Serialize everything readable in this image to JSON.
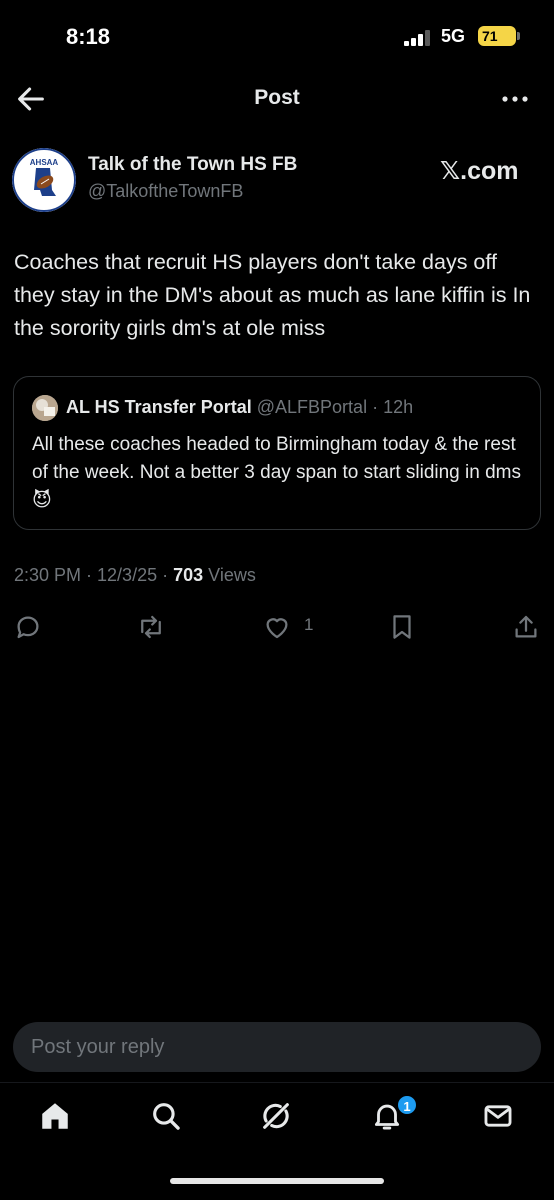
{
  "status_bar": {
    "time": "8:18",
    "network": "5G",
    "battery": "71"
  },
  "header": {
    "title": "Post"
  },
  "post": {
    "author_name": "Talk of the Town HS FB",
    "author_handle": "@TalkoftheTownFB",
    "avatar_text": "AHSAA",
    "source_label": "𝕏.com",
    "body": "Coaches that recruit HS players don't take days off they stay in the DM's about as much as lane kiffin is In the sorority girls dm's at ole miss",
    "quote": {
      "author_name": "AL HS Transfer Portal",
      "author_handle": "@ALFBPortal",
      "time": "· 12h",
      "text": "All these coaches headed to Birmingham today & the rest of the week. Not a better 3 day span to start sliding in dms 😈"
    },
    "timestamp": "2:30 PM · 12/3/25 · ",
    "views_count": "703",
    "views_label": " Views",
    "likes_count": "1"
  },
  "reply": {
    "placeholder": "Post your reply"
  },
  "nav": {
    "notifications_badge": "1"
  },
  "colors": {
    "background": "#000000",
    "text": "#e7e9ea",
    "muted": "#71767b",
    "accent": "#1d9bf0",
    "battery": "#f5d547"
  },
  "icons": [
    "back-arrow-icon",
    "more-icon",
    "reply-icon",
    "repost-icon",
    "like-icon",
    "bookmark-icon",
    "share-icon",
    "home-icon",
    "search-icon",
    "grok-icon",
    "notifications-icon",
    "messages-icon"
  ]
}
